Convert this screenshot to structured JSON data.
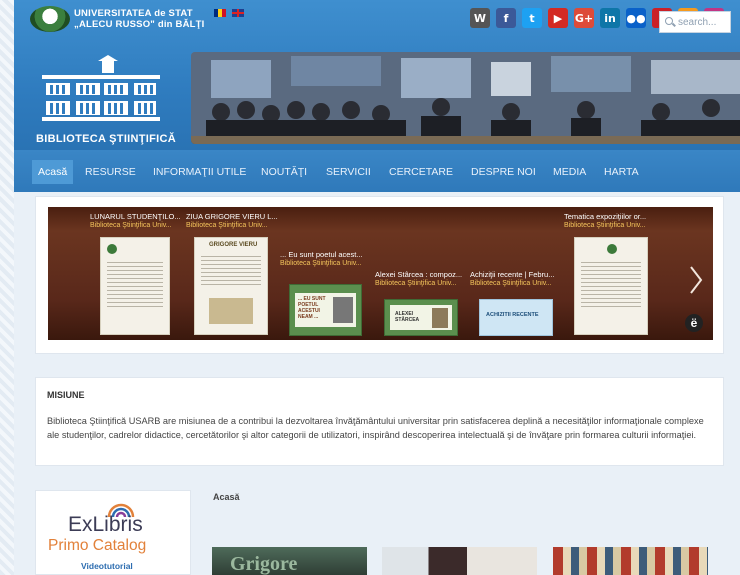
{
  "header": {
    "university_line1": "UNIVERSITATEA de STAT",
    "university_line2": "„ALECU RUSSO\" din BĂLŢI",
    "library_title": "BIBLIOTECA ŞTIINŢIFICĂ"
  },
  "social": [
    {
      "name": "wikipedia-icon",
      "glyph": "W",
      "color": "#555555"
    },
    {
      "name": "facebook-icon",
      "glyph": "f",
      "color": "#3b5998"
    },
    {
      "name": "twitter-icon",
      "glyph": "t",
      "color": "#1da1f2"
    },
    {
      "name": "youtube-icon",
      "glyph": "▶",
      "color": "#d32a23"
    },
    {
      "name": "googleplus-icon",
      "glyph": "G+",
      "color": "#dd4b39"
    },
    {
      "name": "linkedin-icon",
      "glyph": "in",
      "color": "#0e76a8"
    },
    {
      "name": "flickr-icon",
      "glyph": "●●",
      "color": "#0a61c9"
    },
    {
      "name": "pinterest-icon",
      "glyph": "p",
      "color": "#cb2027"
    },
    {
      "name": "odnoklassniki-icon",
      "glyph": "ok",
      "color": "#f59a1e"
    },
    {
      "name": "instagram-icon",
      "glyph": "◎",
      "color": "#c13584"
    }
  ],
  "nav": {
    "items": [
      "Acasă",
      "RESURSE",
      "INFORMAŢII UTILE",
      "NOUTĂŢI",
      "SERVICII",
      "CERCETARE",
      "DESPRE NOI",
      "MEDIA",
      "HARTA"
    ],
    "search_placeholder": "search..."
  },
  "carousel": {
    "items": [
      {
        "title": "LUNARUL STUDENŢILO...",
        "source": "Biblioteca Ştiinţifica Univ..."
      },
      {
        "title": "ZIUA GRIGORE VIERU L...",
        "source": "Biblioteca Ştiinţifica Univ..."
      },
      {
        "title": "... Eu sunt poetul acest...",
        "source": "Biblioteca Ştiinţifica Univ..."
      },
      {
        "title": "Alexei Stârcea : compoz...",
        "source": "Biblioteca Ştiinţifica Univ..."
      },
      {
        "title": "Achiziţii recente | Febru...",
        "source": "Biblioteca Ştiinţifica Univ..."
      },
      {
        "title": "Tematica expoziţiilor or...",
        "source": "Biblioteca Ştiinţifica Univ..."
      }
    ],
    "doc_texts": {
      "grigore": "GRIGORE VIERU",
      "poet": "... EU SUNT POETUL ACESTUI NEAM ...",
      "alexei": "ALEXEI STÂRCEA",
      "achizitii": "ACHIZITII RECENTE"
    },
    "badge": "ë"
  },
  "mission": {
    "title": "MISIUNE",
    "text": "Biblioteca Ştiinţifică USARB are misiunea de a contribui la dezvoltarea învăţământului universitar prin satisfacerea deplină a necesităţilor informaţionale complexe ale studenţilor, cadrelor didactice, cercetătorilor şi altor categorii de utilizatori, inspirând descoperirea intelectuală şi de învăţare prin formarea culturii informaţiei."
  },
  "sidebar": {
    "exlibris": "ExLibris",
    "primo": "Primo Catalog",
    "videotutorial": "Videotutorial"
  },
  "main": {
    "heading": "Acasă",
    "thumb1_text": "Grigore"
  }
}
